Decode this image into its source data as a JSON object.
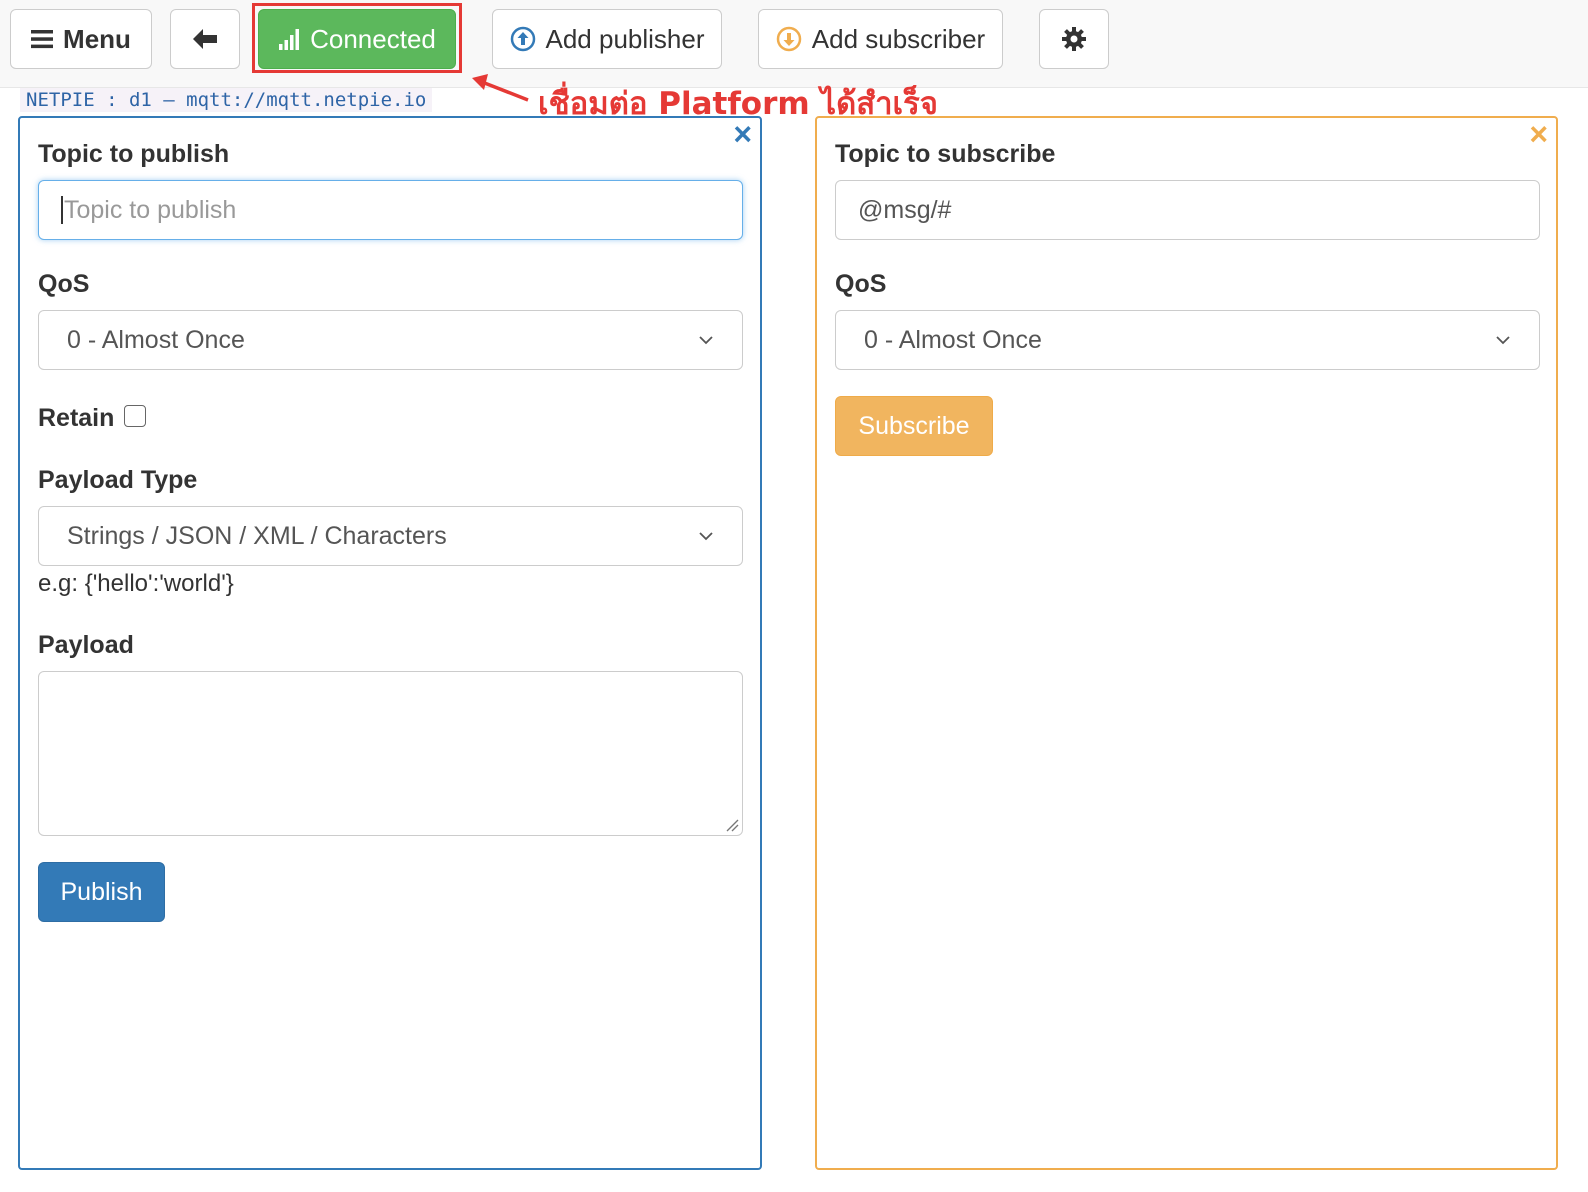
{
  "toolbar": {
    "menu_label": "Menu",
    "connected_label": "Connected",
    "add_publisher_label": "Add publisher",
    "add_subscriber_label": "Add subscriber"
  },
  "connection": {
    "info": "NETPIE : d1 – mqtt://mqtt.netpie.io"
  },
  "annotation": {
    "text": "เชื่อมต่อ Platform ได้สำเร็จ",
    "color": "#e53935"
  },
  "publisher": {
    "close_icon": "×",
    "topic_label": "Topic to publish",
    "topic_placeholder": "Topic to publish",
    "topic_value": "",
    "qos_label": "QoS",
    "qos_selected": "0 - Almost Once",
    "retain_label": "Retain",
    "retain_checked": false,
    "payload_type_label": "Payload Type",
    "payload_type_selected": "Strings / JSON / XML / Characters",
    "payload_hint": "e.g: {'hello':'world'}",
    "payload_label": "Payload",
    "payload_value": "",
    "publish_label": "Publish",
    "accent": "#337ab7"
  },
  "subscriber": {
    "close_icon": "×",
    "topic_label": "Topic to subscribe",
    "topic_value": "@msg/#",
    "qos_label": "QoS",
    "qos_selected": "0 - Almost Once",
    "subscribe_label": "Subscribe",
    "accent": "#f0ad4e"
  },
  "icons": {
    "menu": "hamburger-icon",
    "back": "arrow-left-icon",
    "signal": "signal-bars-icon",
    "publish": "arrow-circle-up-icon",
    "subscribe": "arrow-circle-down-icon",
    "settings": "gear-icon"
  },
  "colors": {
    "connected": "#5cb85c",
    "primary": "#337ab7",
    "warning": "#f0ad4e"
  }
}
